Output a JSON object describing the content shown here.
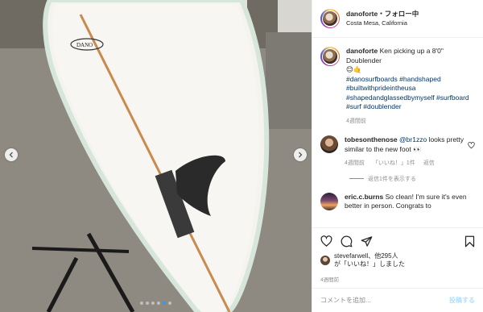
{
  "header": {
    "username": "danoforte",
    "follow": "・フォロー中",
    "location": "Costa Mesa, California"
  },
  "caption": {
    "username": "danoforte",
    "text": "Ken picking up a 8'0\" Doublender",
    "emoji": "😊🤙",
    "hashtags": "#danosurfboards #handshaped #builtwithprideintheusa #shapedandglassedbymyself #surfboard #surf #doublender",
    "time": "4週間前"
  },
  "comments": [
    {
      "username": "tobesonthenose",
      "mention": "@br1zzo",
      "text": "looks pretty similar to the new foot 👀",
      "time": "4週間前",
      "likes": "「いいね！」1件",
      "reply": "返信",
      "replies_label": "返信1件を表示する"
    },
    {
      "username": "eric.c.burns",
      "text": "So clean! I'm sure it's even better in person. Congrats to"
    }
  ],
  "likes": {
    "line1": "stevefarwell、他295人",
    "line2": "が「いいね！」しました"
  },
  "date": "4週間前",
  "add_comment": {
    "placeholder": "コメントを追加...",
    "post_label": "投稿する"
  },
  "carousel": {
    "slides": 6,
    "active_index": 4,
    "accent": "#3897f0"
  },
  "icons": [
    "chevron-left-icon",
    "chevron-right-icon",
    "heart-icon",
    "comment-icon",
    "share-icon",
    "bookmark-icon",
    "more-icon",
    "smiley-icon"
  ],
  "colors": {
    "link": "#00376b",
    "muted": "#8e8e8e",
    "post_disabled": "#b2dffc"
  }
}
